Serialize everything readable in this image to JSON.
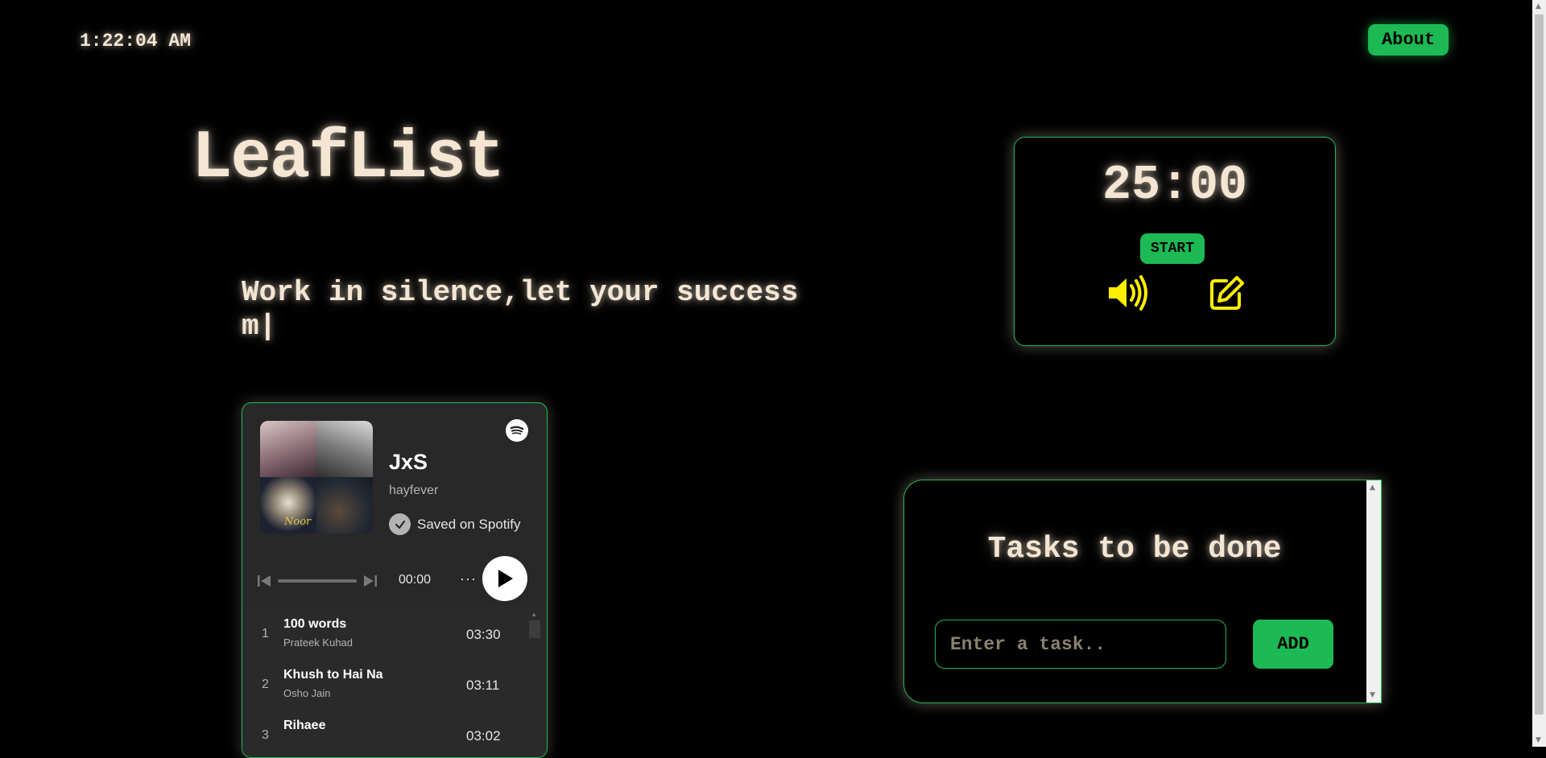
{
  "header": {
    "clock": "1:22:04 AM",
    "about_label": "About"
  },
  "app_title": "LeafList",
  "quote": "Work in silence,let your success m|",
  "timer": {
    "display": "25:00",
    "start_label": "START",
    "sound_icon": "speaker-icon",
    "edit_icon": "edit-icon"
  },
  "spotify": {
    "cover_text": "Noor",
    "playlist_title": "JxS",
    "owner": "hayfever",
    "saved_label": "Saved on Spotify",
    "elapsed": "00:00",
    "more": "···",
    "tracks": [
      {
        "num": "1",
        "name": "100 words",
        "artist": "Prateek Kuhad",
        "duration": "03:30"
      },
      {
        "num": "2",
        "name": "Khush to Hai Na",
        "artist": "Osho Jain",
        "duration": "03:11"
      },
      {
        "num": "3",
        "name": "Rihaee",
        "artist": "",
        "duration": "03:02"
      }
    ]
  },
  "tasks": {
    "title": "Tasks to be done",
    "input_placeholder": "Enter a task..",
    "add_label": "ADD"
  },
  "colors": {
    "accent": "#1db954",
    "text": "#f5e6d3",
    "icon_yellow": "#ffee00",
    "background": "#000000"
  }
}
